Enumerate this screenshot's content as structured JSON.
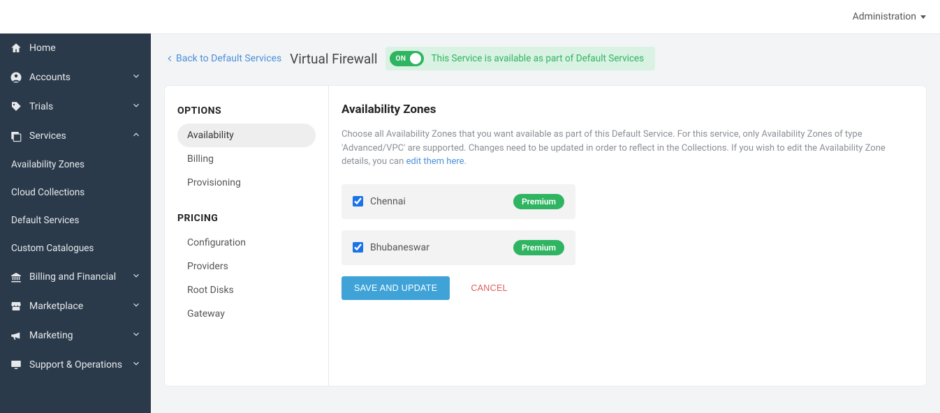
{
  "topbar": {
    "admin_label": "Administration"
  },
  "sidebar": {
    "home": "Home",
    "accounts": "Accounts",
    "trials": "Trials",
    "services": "Services",
    "services_sub": {
      "availability_zones": "Availability Zones",
      "cloud_collections": "Cloud Collections",
      "default_services": "Default Services",
      "custom_catalogues": "Custom Catalogues"
    },
    "billing_financial": "Billing and Financial",
    "marketplace": "Marketplace",
    "marketing": "Marketing",
    "support_operations": "Support & Operations"
  },
  "header": {
    "back_label": "Back to Default Services",
    "title": "Virtual Firewall",
    "toggle_on_label": "ON",
    "status_text": "This Service is available as part of Default Services"
  },
  "options_panel": {
    "heading_options": "OPTIONS",
    "availability": "Availability",
    "billing": "Billing",
    "provisioning": "Provisioning",
    "heading_pricing": "PRICING",
    "configuration": "Configuration",
    "providers": "Providers",
    "root_disks": "Root Disks",
    "gateway": "Gateway"
  },
  "main_panel": {
    "title": "Availability Zones",
    "help_text_1": "Choose all Availability Zones that you want available as part of this Default Service. For this service, only Availability Zones of type 'Advanced/VPC' are supported. Changes need to be updated in order to reflect in the Collections. If you wish to edit the Availability Zone details, you can ",
    "help_link": "edit them here",
    "help_text_2": ".",
    "zones": [
      {
        "name": "Chennai",
        "badge": "Premium",
        "checked": true
      },
      {
        "name": "Bhubaneswar",
        "badge": "Premium",
        "checked": true
      }
    ],
    "save_label": "SAVE AND UPDATE",
    "cancel_label": "CANCEL"
  }
}
